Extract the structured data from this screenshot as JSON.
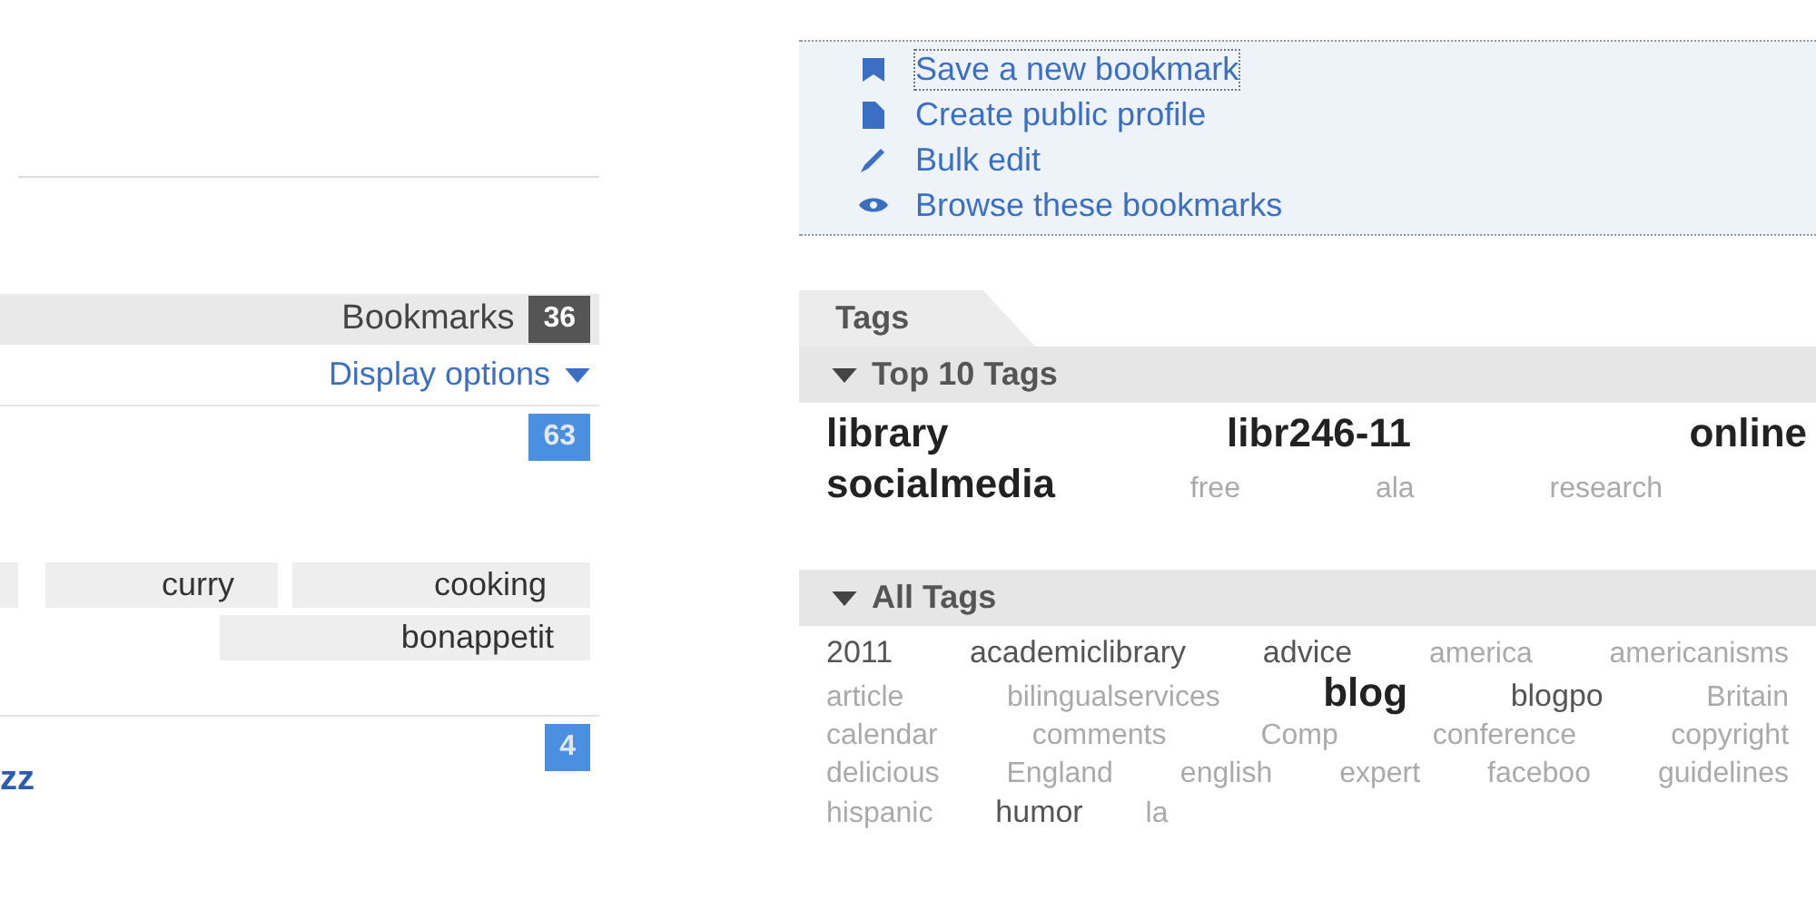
{
  "actions": [
    {
      "label": "Save a new bookmark",
      "kind": "flag",
      "focused": true
    },
    {
      "label": "Create public profile",
      "kind": "page",
      "focused": false
    },
    {
      "label": "Bulk edit",
      "kind": "pencil",
      "focused": false
    },
    {
      "label": "Browse these bookmarks",
      "kind": "eye",
      "focused": false
    }
  ],
  "bookmarks_panel": {
    "label": "Bookmarks",
    "count": "36",
    "display_options": "Display options",
    "bookmarks": [
      {
        "count": "63",
        "tag_rows": [
          [
            "curry",
            "cooking"
          ],
          [
            "bonappetit"
          ]
        ]
      },
      {
        "title": "zz",
        "count": "4"
      }
    ]
  },
  "tags_panel": {
    "tab": "Tags",
    "sections": [
      {
        "title": "Top 10 Tags",
        "expanded": true,
        "tags": [
          {
            "label": "library",
            "kind": "big"
          },
          {
            "label": "libr246-11",
            "kind": "big"
          },
          {
            "label": "online",
            "kind": "big"
          },
          {
            "label": "socialmedia",
            "kind": "big"
          },
          {
            "label": "free",
            "kind": "light"
          },
          {
            "label": "ala",
            "kind": "light"
          },
          {
            "label": "research",
            "kind": "light"
          }
        ]
      },
      {
        "title": "All Tags",
        "expanded": true,
        "tags": [
          {
            "label": "2011",
            "kind": "dark"
          },
          {
            "label": "academiclibrary",
            "kind": "dark"
          },
          {
            "label": "advice",
            "kind": "dark"
          },
          {
            "label": "america",
            "kind": "light"
          },
          {
            "label": "americanisms",
            "kind": "light"
          },
          {
            "label": "article",
            "kind": "light"
          },
          {
            "label": "bilingualservices",
            "kind": "light"
          },
          {
            "label": "blog",
            "kind": "big"
          },
          {
            "label": "blogpo",
            "kind": "dark"
          },
          {
            "label": "Britain",
            "kind": "light"
          },
          {
            "label": "calendar",
            "kind": "light"
          },
          {
            "label": "comments",
            "kind": "light"
          },
          {
            "label": "Comp",
            "kind": "light"
          },
          {
            "label": "conference",
            "kind": "light"
          },
          {
            "label": "copyright",
            "kind": "light"
          },
          {
            "label": "delicious",
            "kind": "light"
          },
          {
            "label": "England",
            "kind": "light"
          },
          {
            "label": "english",
            "kind": "light"
          },
          {
            "label": "expert",
            "kind": "light"
          },
          {
            "label": "faceboo",
            "kind": "light"
          },
          {
            "label": "guidelines",
            "kind": "light"
          },
          {
            "label": "hispanic",
            "kind": "light"
          },
          {
            "label": "humor",
            "kind": "dark"
          },
          {
            "label": "la",
            "kind": "light"
          }
        ]
      }
    ]
  }
}
